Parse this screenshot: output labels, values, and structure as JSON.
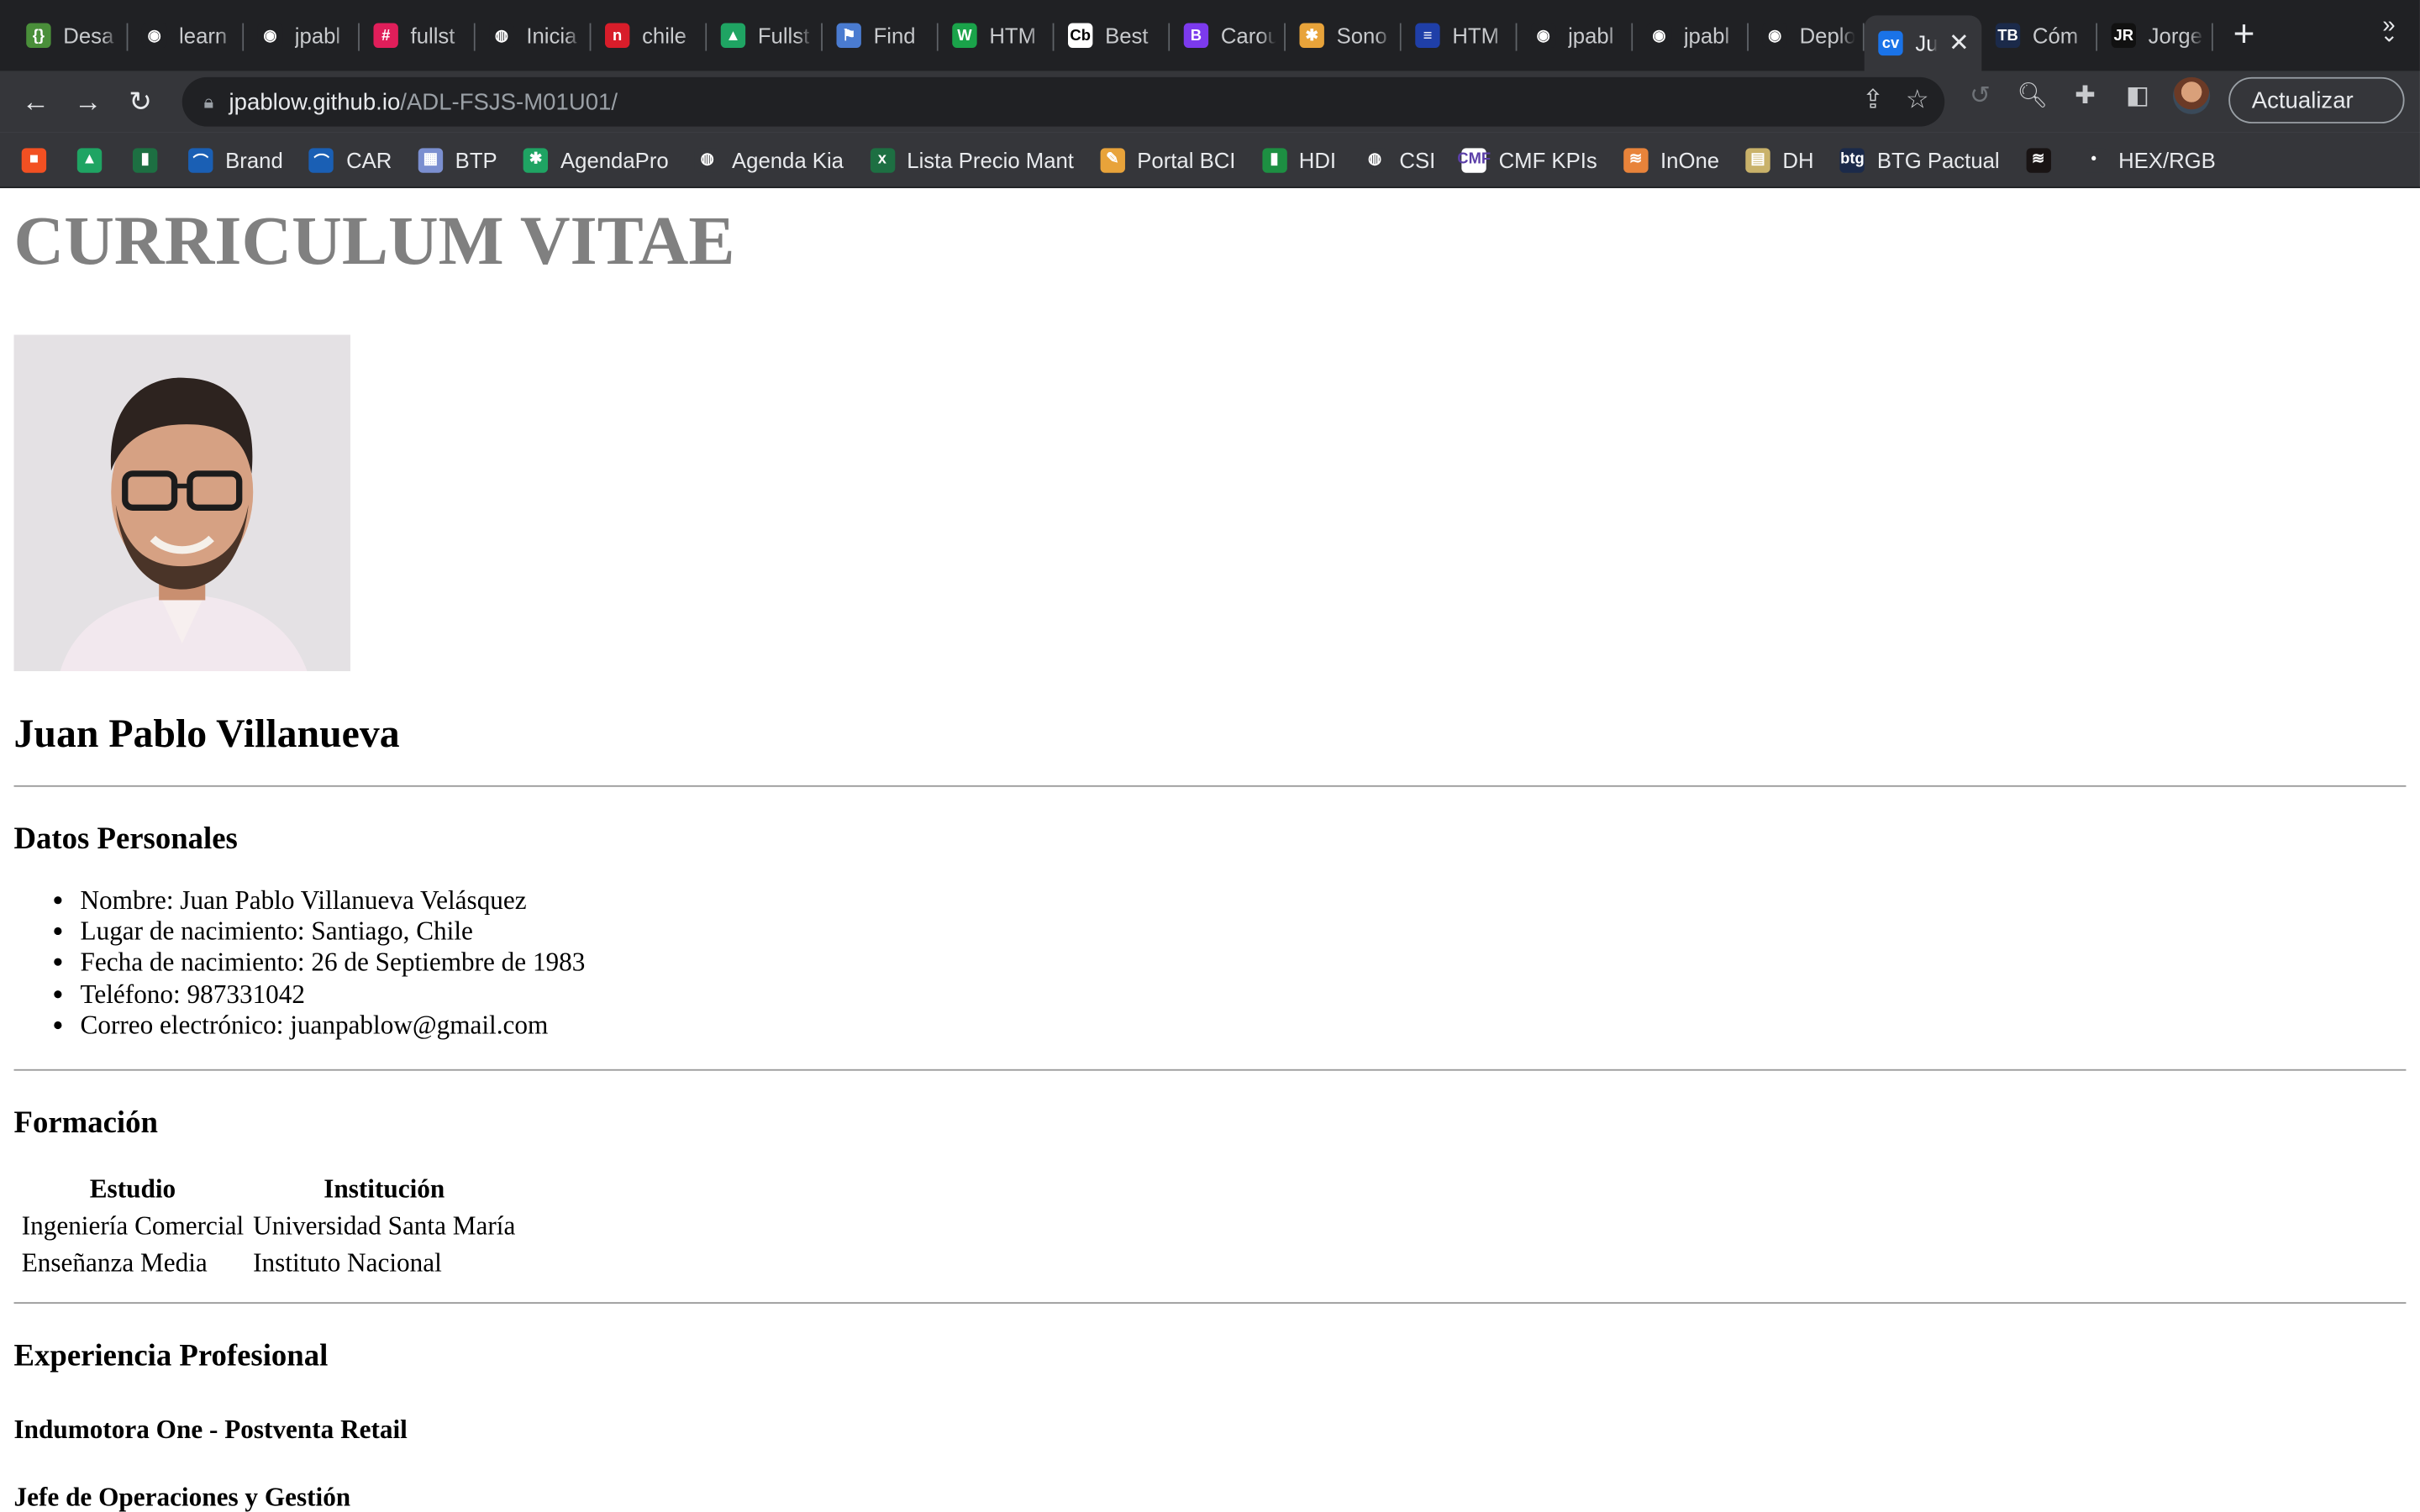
{
  "browser": {
    "tabs": [
      {
        "label": "Desa",
        "color": "#4a8f3a",
        "glyph": "{}"
      },
      {
        "label": "learn",
        "color": "#202124",
        "glyph": "◉"
      },
      {
        "label": "jpabl",
        "color": "#202124",
        "glyph": "◉"
      },
      {
        "label": "fullst",
        "color": "#e01e5a",
        "glyph": "#"
      },
      {
        "label": "Inicia",
        "color": "#202124",
        "glyph": "◍"
      },
      {
        "label": "chile",
        "color": "#d81d2a",
        "glyph": "n"
      },
      {
        "label": "Fullst",
        "color": "#1fa463",
        "glyph": "▲"
      },
      {
        "label": "Find",
        "color": "#4a7bd0",
        "glyph": "⚑"
      },
      {
        "label": "HTM",
        "color": "#1aa34a",
        "glyph": "W"
      },
      {
        "label": "Best",
        "color": "#ffffff",
        "glyph": "Cb"
      },
      {
        "label": "Carou",
        "color": "#7c3aed",
        "glyph": "B"
      },
      {
        "label": "Sono",
        "color": "#e8a33a",
        "glyph": "✱"
      },
      {
        "label": "HTM",
        "color": "#1f3fa8",
        "glyph": "≡"
      },
      {
        "label": "jpabl",
        "color": "#202124",
        "glyph": "◉"
      },
      {
        "label": "jpabl",
        "color": "#202124",
        "glyph": "◉"
      },
      {
        "label": "Deplo",
        "color": "#202124",
        "glyph": "◉"
      },
      {
        "label": "Ju",
        "color": "#1a73e8",
        "glyph": "cv",
        "active": true
      },
      {
        "label": "Cóm",
        "color": "#1b2a4a",
        "glyph": "TB"
      },
      {
        "label": "Jorge",
        "color": "#111111",
        "glyph": "JR"
      }
    ],
    "url_host": "jpablow.github.io",
    "url_path": "/ADL-FSJS-M01U01/",
    "update_label": "Actualizar",
    "bookmarks": [
      {
        "label": "",
        "color": "#f25022",
        "glyph": "■"
      },
      {
        "label": "",
        "color": "#1fa463",
        "glyph": "▲"
      },
      {
        "label": "",
        "color": "#1d6f42",
        "glyph": "▮"
      },
      {
        "label": "Brand",
        "color": "#1a5fb4",
        "glyph": "⌒"
      },
      {
        "label": "CAR",
        "color": "#1a5fb4",
        "glyph": "⌒"
      },
      {
        "label": "BTP",
        "color": "#7b8fd0",
        "glyph": "▦"
      },
      {
        "label": "AgendaPro",
        "color": "#1fa463",
        "glyph": "✱"
      },
      {
        "label": "Agenda Kia",
        "color": "#35363a",
        "glyph": "◍"
      },
      {
        "label": "Lista Precio Mant",
        "color": "#1d6f42",
        "glyph": "x"
      },
      {
        "label": "Portal BCI",
        "color": "#e8a33a",
        "glyph": "✎"
      },
      {
        "label": "HDI",
        "color": "#1d8f42",
        "glyph": "▮"
      },
      {
        "label": "CSI",
        "color": "#35363a",
        "glyph": "◍"
      },
      {
        "label": "CMF KPIs",
        "color": "#ffffff",
        "glyph": "CMF"
      },
      {
        "label": "InOne",
        "color": "#e8833a",
        "glyph": "≋"
      },
      {
        "label": "DH",
        "color": "#c9b26a",
        "glyph": "▤"
      },
      {
        "label": "BTG Pactual",
        "color": "#1b2a4a",
        "glyph": "btg"
      },
      {
        "label": "",
        "color": "#191414",
        "glyph": "≋"
      },
      {
        "label": "HEX/RGB",
        "color": "#35363a",
        "glyph": "•"
      }
    ],
    "more_label": "»"
  },
  "cv": {
    "title": "CURRICULUM VITAE",
    "name": "Juan Pablo Villanueva",
    "personal": {
      "heading": "Datos Personales",
      "items": [
        "Nombre: Juan Pablo Villanueva Velásquez",
        "Lugar de nacimiento: Santiago, Chile",
        "Fecha de nacimiento: 26 de Septiembre de 1983",
        "Teléfono: 987331042",
        "Correo electrónico: juanpablow@gmail.com"
      ]
    },
    "education": {
      "heading": "Formación",
      "columns": [
        "Estudio",
        "Institución"
      ],
      "rows": [
        [
          "Ingeniería Comercial",
          "Universidad Santa María"
        ],
        [
          "Enseñanza Media",
          "Instituto Nacional"
        ]
      ]
    },
    "experience": {
      "heading": "Experiencia Profesional",
      "company": "Indumotora One - Postventa Retail",
      "role": "Jefe de Operaciones y Gestión"
    }
  }
}
